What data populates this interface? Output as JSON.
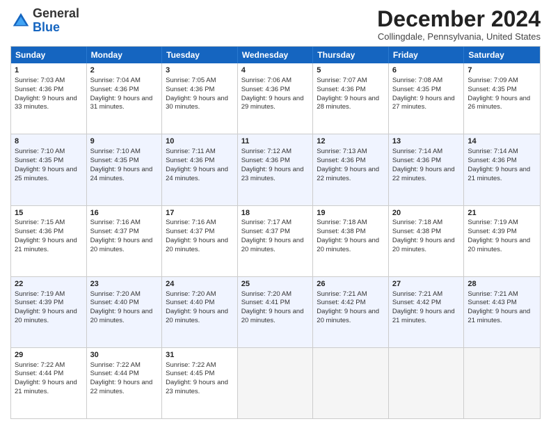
{
  "header": {
    "logo_general": "General",
    "logo_blue": "Blue",
    "title": "December 2024",
    "location": "Collingdale, Pennsylvania, United States"
  },
  "days": [
    "Sunday",
    "Monday",
    "Tuesday",
    "Wednesday",
    "Thursday",
    "Friday",
    "Saturday"
  ],
  "weeks": [
    [
      {
        "day": "1",
        "sunrise": "7:03 AM",
        "sunset": "4:36 PM",
        "daylight": "9 hours and 33 minutes."
      },
      {
        "day": "2",
        "sunrise": "7:04 AM",
        "sunset": "4:36 PM",
        "daylight": "9 hours and 31 minutes."
      },
      {
        "day": "3",
        "sunrise": "7:05 AM",
        "sunset": "4:36 PM",
        "daylight": "9 hours and 30 minutes."
      },
      {
        "day": "4",
        "sunrise": "7:06 AM",
        "sunset": "4:36 PM",
        "daylight": "9 hours and 29 minutes."
      },
      {
        "day": "5",
        "sunrise": "7:07 AM",
        "sunset": "4:36 PM",
        "daylight": "9 hours and 28 minutes."
      },
      {
        "day": "6",
        "sunrise": "7:08 AM",
        "sunset": "4:35 PM",
        "daylight": "9 hours and 27 minutes."
      },
      {
        "day": "7",
        "sunrise": "7:09 AM",
        "sunset": "4:35 PM",
        "daylight": "9 hours and 26 minutes."
      }
    ],
    [
      {
        "day": "8",
        "sunrise": "7:10 AM",
        "sunset": "4:35 PM",
        "daylight": "9 hours and 25 minutes."
      },
      {
        "day": "9",
        "sunrise": "7:10 AM",
        "sunset": "4:35 PM",
        "daylight": "9 hours and 24 minutes."
      },
      {
        "day": "10",
        "sunrise": "7:11 AM",
        "sunset": "4:36 PM",
        "daylight": "9 hours and 24 minutes."
      },
      {
        "day": "11",
        "sunrise": "7:12 AM",
        "sunset": "4:36 PM",
        "daylight": "9 hours and 23 minutes."
      },
      {
        "day": "12",
        "sunrise": "7:13 AM",
        "sunset": "4:36 PM",
        "daylight": "9 hours and 22 minutes."
      },
      {
        "day": "13",
        "sunrise": "7:14 AM",
        "sunset": "4:36 PM",
        "daylight": "9 hours and 22 minutes."
      },
      {
        "day": "14",
        "sunrise": "7:14 AM",
        "sunset": "4:36 PM",
        "daylight": "9 hours and 21 minutes."
      }
    ],
    [
      {
        "day": "15",
        "sunrise": "7:15 AM",
        "sunset": "4:36 PM",
        "daylight": "9 hours and 21 minutes."
      },
      {
        "day": "16",
        "sunrise": "7:16 AM",
        "sunset": "4:37 PM",
        "daylight": "9 hours and 20 minutes."
      },
      {
        "day": "17",
        "sunrise": "7:16 AM",
        "sunset": "4:37 PM",
        "daylight": "9 hours and 20 minutes."
      },
      {
        "day": "18",
        "sunrise": "7:17 AM",
        "sunset": "4:37 PM",
        "daylight": "9 hours and 20 minutes."
      },
      {
        "day": "19",
        "sunrise": "7:18 AM",
        "sunset": "4:38 PM",
        "daylight": "9 hours and 20 minutes."
      },
      {
        "day": "20",
        "sunrise": "7:18 AM",
        "sunset": "4:38 PM",
        "daylight": "9 hours and 20 minutes."
      },
      {
        "day": "21",
        "sunrise": "7:19 AM",
        "sunset": "4:39 PM",
        "daylight": "9 hours and 20 minutes."
      }
    ],
    [
      {
        "day": "22",
        "sunrise": "7:19 AM",
        "sunset": "4:39 PM",
        "daylight": "9 hours and 20 minutes."
      },
      {
        "day": "23",
        "sunrise": "7:20 AM",
        "sunset": "4:40 PM",
        "daylight": "9 hours and 20 minutes."
      },
      {
        "day": "24",
        "sunrise": "7:20 AM",
        "sunset": "4:40 PM",
        "daylight": "9 hours and 20 minutes."
      },
      {
        "day": "25",
        "sunrise": "7:20 AM",
        "sunset": "4:41 PM",
        "daylight": "9 hours and 20 minutes."
      },
      {
        "day": "26",
        "sunrise": "7:21 AM",
        "sunset": "4:42 PM",
        "daylight": "9 hours and 20 minutes."
      },
      {
        "day": "27",
        "sunrise": "7:21 AM",
        "sunset": "4:42 PM",
        "daylight": "9 hours and 21 minutes."
      },
      {
        "day": "28",
        "sunrise": "7:21 AM",
        "sunset": "4:43 PM",
        "daylight": "9 hours and 21 minutes."
      }
    ],
    [
      {
        "day": "29",
        "sunrise": "7:22 AM",
        "sunset": "4:44 PM",
        "daylight": "9 hours and 21 minutes."
      },
      {
        "day": "30",
        "sunrise": "7:22 AM",
        "sunset": "4:44 PM",
        "daylight": "9 hours and 22 minutes."
      },
      {
        "day": "31",
        "sunrise": "7:22 AM",
        "sunset": "4:45 PM",
        "daylight": "9 hours and 23 minutes."
      },
      null,
      null,
      null,
      null
    ]
  ]
}
